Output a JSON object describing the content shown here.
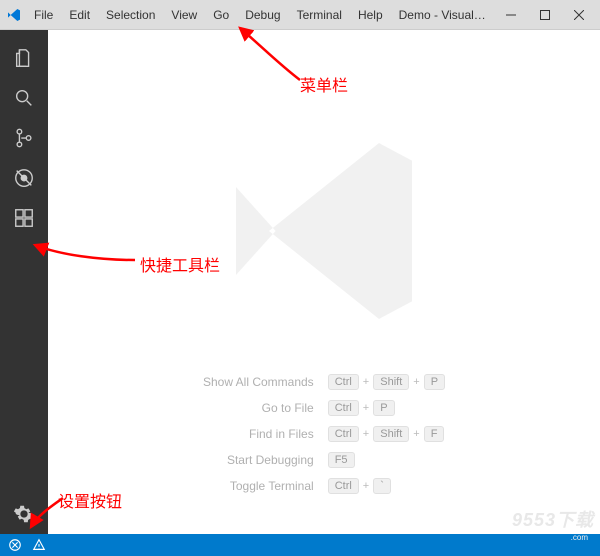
{
  "titlebar": {
    "title": "Demo - Visual Studio C...",
    "menu": [
      "File",
      "Edit",
      "Selection",
      "View",
      "Go",
      "Debug",
      "Terminal",
      "Help"
    ]
  },
  "activity": {
    "items": [
      "explorer",
      "search",
      "source-control",
      "debug",
      "extensions"
    ],
    "bottom": "settings"
  },
  "shortcuts": [
    {
      "label": "Show All Commands",
      "keys": [
        "Ctrl",
        "Shift",
        "P"
      ]
    },
    {
      "label": "Go to File",
      "keys": [
        "Ctrl",
        "P"
      ]
    },
    {
      "label": "Find in Files",
      "keys": [
        "Ctrl",
        "Shift",
        "F"
      ]
    },
    {
      "label": "Start Debugging",
      "keys": [
        "F5"
      ]
    },
    {
      "label": "Toggle Terminal",
      "keys": [
        "Ctrl",
        "`"
      ]
    }
  ],
  "annotations": {
    "menu": "菜单栏",
    "activity": "快捷工具栏",
    "settings": "设置按钮"
  },
  "watermark": {
    "main": "9553下载",
    "sub": ".com"
  }
}
